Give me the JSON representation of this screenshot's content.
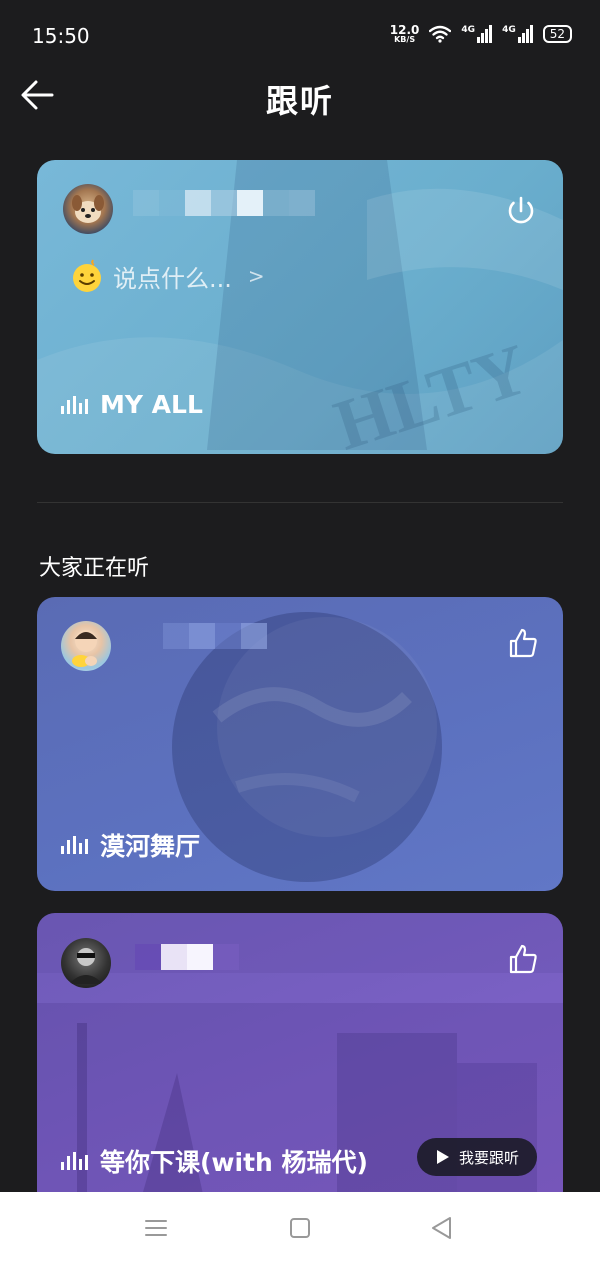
{
  "status_bar": {
    "time": "15:50",
    "net_speed_value": "12.0",
    "net_speed_unit": "KB/S",
    "signal1_label": "4G",
    "signal2_label": "4G",
    "battery": "52",
    "icons": [
      "wifi-icon",
      "signal-icon",
      "signal-icon",
      "battery-icon"
    ]
  },
  "header": {
    "title": "跟听",
    "back_icon": "arrow-left-icon"
  },
  "my_card": {
    "say_placeholder": "说点什么...",
    "say_chevron": ">",
    "song": "MY ALL",
    "power_icon": "power-icon",
    "color": "#6aaecd"
  },
  "section": {
    "title": "大家正在听"
  },
  "cards": [
    {
      "song": "漠河舞厅",
      "like_icon": "thumbs-up-icon",
      "color": "#5c71bf"
    },
    {
      "song": "等你下课(with 杨瑞代)",
      "like_icon": "thumbs-up-icon",
      "follow_label": "我要跟听",
      "color": "#7a60c4"
    }
  ],
  "nav": {
    "icons": [
      "menu-icon",
      "home-square-icon",
      "back-triangle-icon"
    ]
  }
}
